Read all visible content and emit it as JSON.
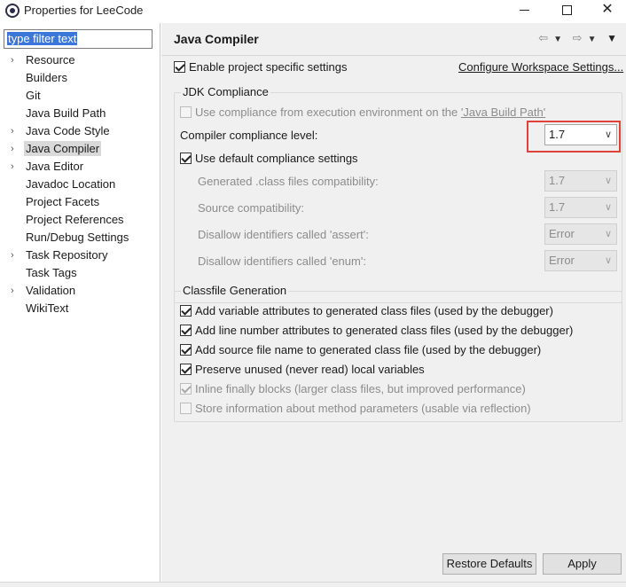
{
  "window": {
    "title": "Properties for LeeCode"
  },
  "sidebar": {
    "filter_placeholder": "type filter text",
    "items": [
      {
        "label": "Resource",
        "expandable": true
      },
      {
        "label": "Builders",
        "expandable": false
      },
      {
        "label": "Git",
        "expandable": false
      },
      {
        "label": "Java Build Path",
        "expandable": false
      },
      {
        "label": "Java Code Style",
        "expandable": true
      },
      {
        "label": "Java Compiler",
        "expandable": true,
        "selected": true
      },
      {
        "label": "Java Editor",
        "expandable": true
      },
      {
        "label": "Javadoc Location",
        "expandable": false
      },
      {
        "label": "Project Facets",
        "expandable": false
      },
      {
        "label": "Project References",
        "expandable": false
      },
      {
        "label": "Run/Debug Settings",
        "expandable": false
      },
      {
        "label": "Task Repository",
        "expandable": true
      },
      {
        "label": "Task Tags",
        "expandable": false
      },
      {
        "label": "Validation",
        "expandable": true
      },
      {
        "label": "WikiText",
        "expandable": false
      }
    ]
  },
  "page": {
    "title": "Java Compiler",
    "enable_project_specific": {
      "label": "Enable project specific settings",
      "checked": true
    },
    "configure_link": "Configure Workspace Settings..."
  },
  "jdk": {
    "group_title": "JDK Compliance",
    "use_env_prefix": "Use compliance from execution environment on the ",
    "use_env_link": "'Java Build Path'",
    "compliance_label": "Compiler compliance level:",
    "compliance_value": "1.7",
    "use_default_label": "Use default compliance settings",
    "generated_label": "Generated .class files compatibility:",
    "generated_value": "1.7",
    "source_label": "Source compatibility:",
    "source_value": "1.7",
    "assert_label": "Disallow identifiers called 'assert':",
    "assert_value": "Error",
    "enum_label": "Disallow identifiers called 'enum':",
    "enum_value": "Error"
  },
  "classfile": {
    "group_title": "Classfile Generation",
    "options": [
      {
        "label": "Add variable attributes to generated class files (used by the debugger)",
        "checked": true,
        "enabled": true
      },
      {
        "label": "Add line number attributes to generated class files (used by the debugger)",
        "checked": true,
        "enabled": true
      },
      {
        "label": "Add source file name to generated class file (used by the debugger)",
        "checked": true,
        "enabled": true
      },
      {
        "label": "Preserve unused (never read) local variables",
        "checked": true,
        "enabled": true
      },
      {
        "label": "Inline finally blocks (larger class files, but improved performance)",
        "checked": true,
        "enabled": false
      },
      {
        "label": "Store information about method parameters (usable via reflection)",
        "checked": false,
        "enabled": false
      }
    ]
  },
  "buttons": {
    "restore_defaults": "Restore Defaults",
    "apply": "Apply"
  },
  "colors": {
    "highlight_border": "#e0413a",
    "filter_selection": "#3b77d8"
  }
}
